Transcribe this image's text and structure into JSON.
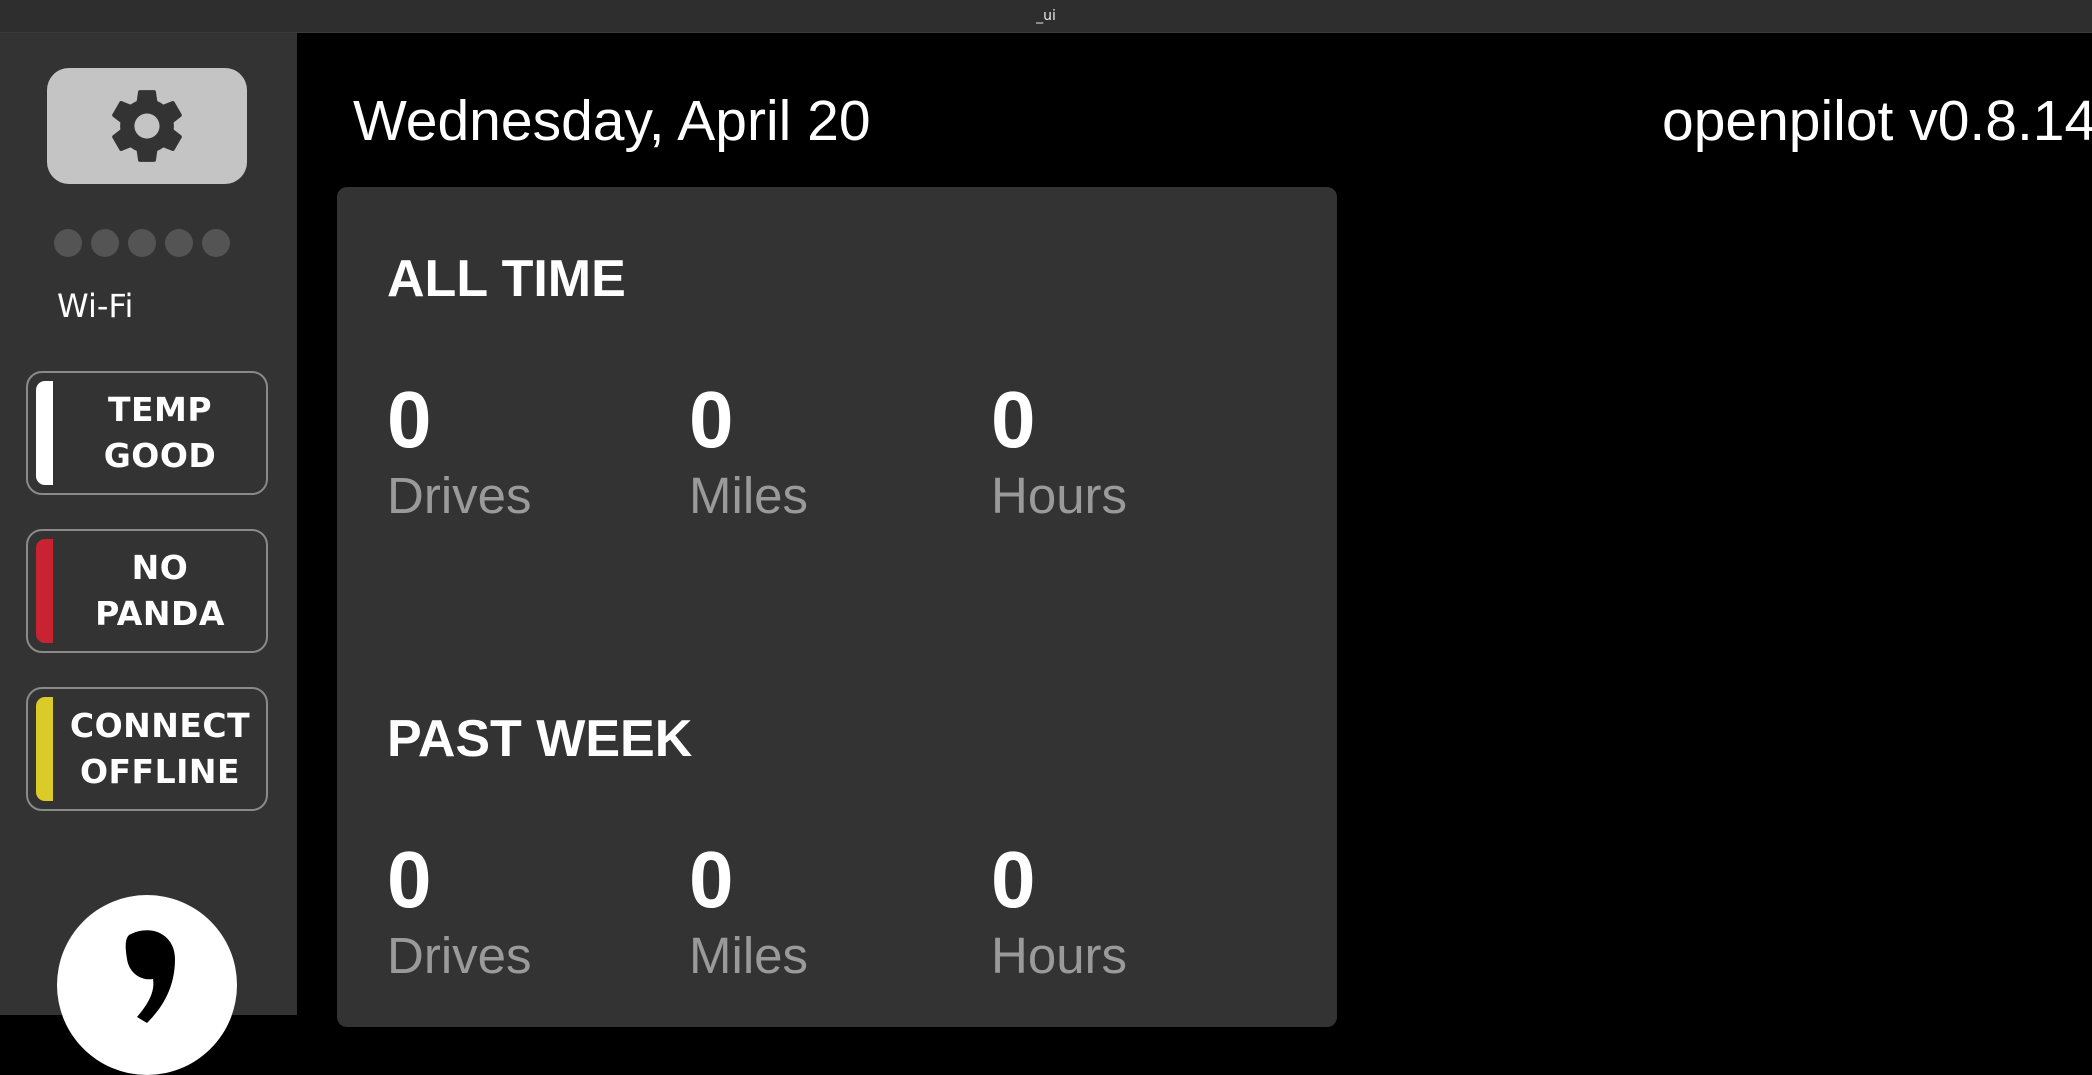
{
  "window": {
    "title": "_ui"
  },
  "sidebar": {
    "settings_icon": "gear-icon",
    "signal_strength_bars": 0,
    "signal_total_bars": 5,
    "network_label": "Wi-Fi",
    "metrics": [
      {
        "line1": "TEMP",
        "line2": "GOOD",
        "status_color": "#ffffff"
      },
      {
        "line1": "NO",
        "line2": "PANDA",
        "status_color": "#c92231"
      },
      {
        "line1": "CONNECT",
        "line2": "OFFLINE",
        "status_color": "#dacb28"
      }
    ],
    "logo_icon": "comma-logo-icon"
  },
  "header": {
    "date": "Wednesday, April 20",
    "version": "openpilot v0.8.14"
  },
  "stats": {
    "all_time": {
      "title": "ALL TIME",
      "drives": {
        "value": "0",
        "label": "Drives"
      },
      "miles": {
        "value": "0",
        "label": "Miles"
      },
      "hours": {
        "value": "0",
        "label": "Hours"
      }
    },
    "past_week": {
      "title": "PAST WEEK",
      "drives": {
        "value": "0",
        "label": "Drives"
      },
      "miles": {
        "value": "0",
        "label": "Miles"
      },
      "hours": {
        "value": "0",
        "label": "Hours"
      }
    }
  },
  "colors": {
    "background": "#000000",
    "panel": "#333333",
    "settings_button": "#c4c4c4",
    "stat_label": "#9a9a9a"
  }
}
